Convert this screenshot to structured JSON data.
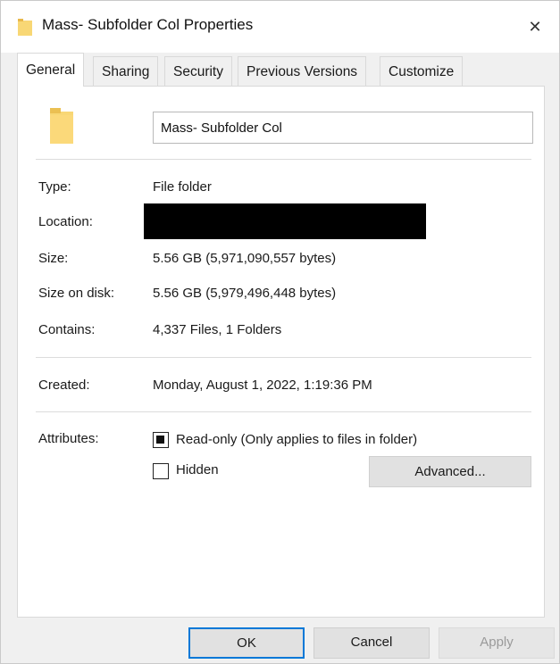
{
  "window": {
    "title": "Mass- Subfolder Col Properties",
    "close_glyph": "✕"
  },
  "tabs": [
    {
      "label": "General",
      "active": true
    },
    {
      "label": "Sharing"
    },
    {
      "label": "Security"
    },
    {
      "label": "Previous Versions"
    },
    {
      "label": "Customize"
    }
  ],
  "general": {
    "folder_name": "Mass- Subfolder Col",
    "folder_icon": "folder-icon",
    "folder_color": "#f8d775",
    "fields": {
      "type": {
        "label": "Type:",
        "value": "File folder"
      },
      "location": {
        "label": "Location:",
        "redacted": true
      },
      "size": {
        "label": "Size:",
        "value": "5.56 GB (5,971,090,557 bytes)"
      },
      "size_on_disk": {
        "label": "Size on disk:",
        "value": "5.56 GB (5,979,496,448 bytes)"
      },
      "contains": {
        "label": "Contains:",
        "value": "4,337 Files, 1 Folders"
      },
      "created": {
        "label": "Created:",
        "value": "Monday, August 1, 2022, 1:19:36 PM"
      }
    },
    "attributes": {
      "label": "Attributes:",
      "readonly": {
        "label": "Read-only (Only applies to files in folder)",
        "state": "indeterminate"
      },
      "hidden": {
        "label": "Hidden",
        "state": "unchecked"
      },
      "advanced_button": "Advanced..."
    }
  },
  "footer": {
    "ok": "OK",
    "cancel": "Cancel",
    "apply": "Apply"
  }
}
